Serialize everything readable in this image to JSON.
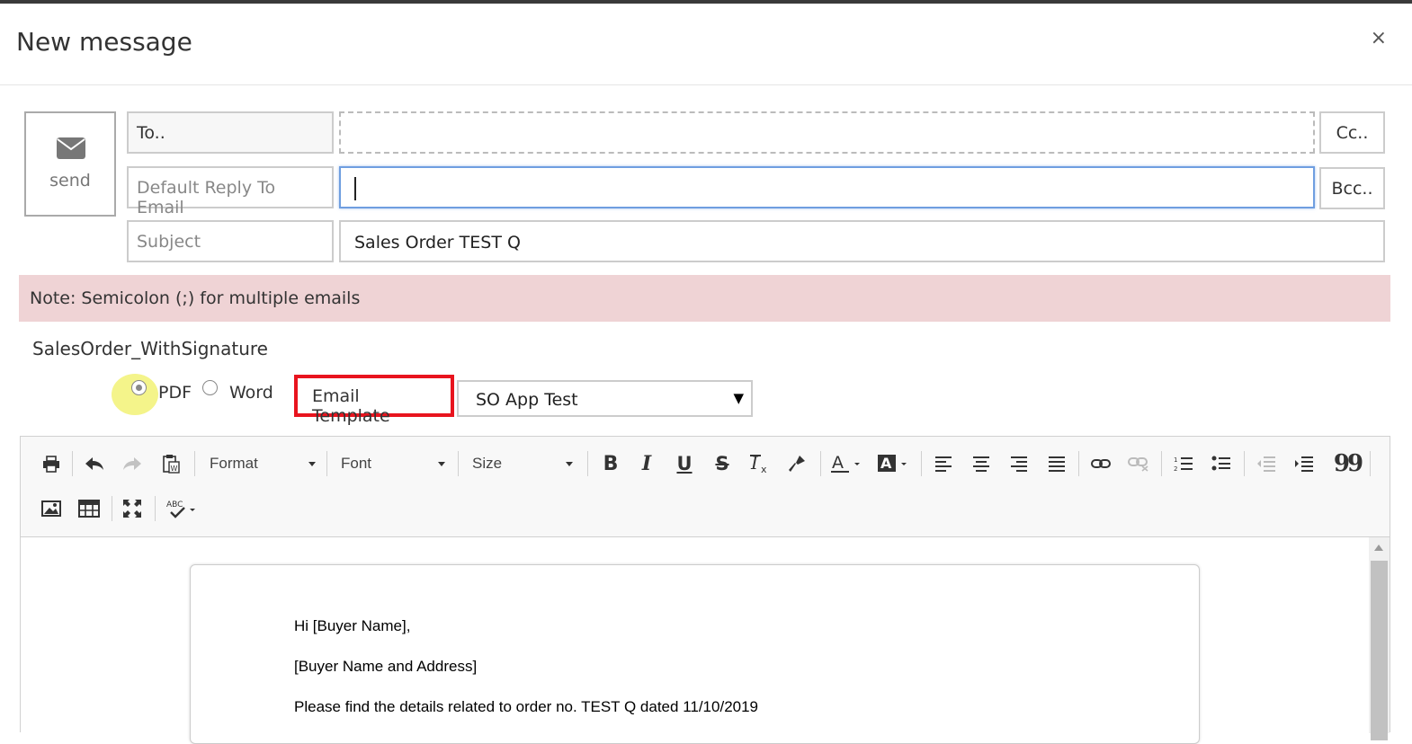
{
  "modal": {
    "title": "New message",
    "close_glyph": "×"
  },
  "send": {
    "label": "send",
    "icon": "envelope-icon"
  },
  "fields": {
    "to_label": "To..",
    "to_value": "",
    "reply_label": "Default Reply To Email",
    "reply_value": "",
    "subject_label": "Subject",
    "subject_value": "Sales Order TEST Q",
    "cc_label": "Cc..",
    "bcc_label": "Bcc.."
  },
  "note": "Note: Semicolon (;) for multiple emails",
  "attachment": {
    "name": "SalesOrder_WithSignature",
    "format_options": [
      "PDF",
      "Word"
    ],
    "selected_format": "PDF"
  },
  "template": {
    "label": "Email Template",
    "selected": "SO App Test",
    "arrow": "▼"
  },
  "toolbar": {
    "format_label": "Format",
    "font_label": "Font",
    "size_label": "Size",
    "bold": "B",
    "italic": "I",
    "underline": "U",
    "strike": "S",
    "blockquote": "99"
  },
  "editor": {
    "lines": [
      "Hi [Buyer Name],",
      "[Buyer Name and Address]",
      "Please find the details related to order no. TEST Q dated 11/10/2019"
    ]
  },
  "colors": {
    "highlight": "#f4f48a",
    "template_border": "#e8141e",
    "note_bg": "#efd3d5",
    "focus": "#6f9ee0"
  }
}
